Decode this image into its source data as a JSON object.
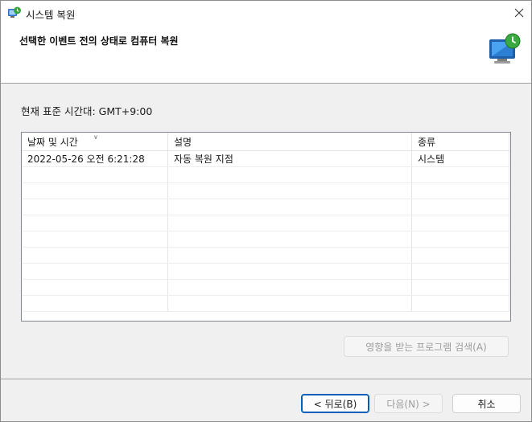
{
  "window": {
    "title": "시스템 복원"
  },
  "header": {
    "title": "선택한 이벤트 전의 상태로 컴퓨터 복원"
  },
  "timezone_label": "현재 표준 시간대: GMT+9:00",
  "table": {
    "columns": [
      "날짜 및 시간",
      "설명",
      "종류"
    ],
    "rows": [
      [
        "2022-05-26 오전 6:21:28",
        "자동 복원 지점",
        "시스템"
      ]
    ]
  },
  "buttons": {
    "affected": "영향을 받는 프로그램 검색(A)",
    "back": "< 뒤로(B)",
    "next": "다음(N) >",
    "cancel": "취소"
  },
  "colors": {
    "accent": "#005fb8",
    "disabled_text": "#9d9d9d"
  },
  "icons": {
    "title": "system-restore-icon",
    "header": "monitor-restore-icon",
    "close": "close-icon"
  }
}
